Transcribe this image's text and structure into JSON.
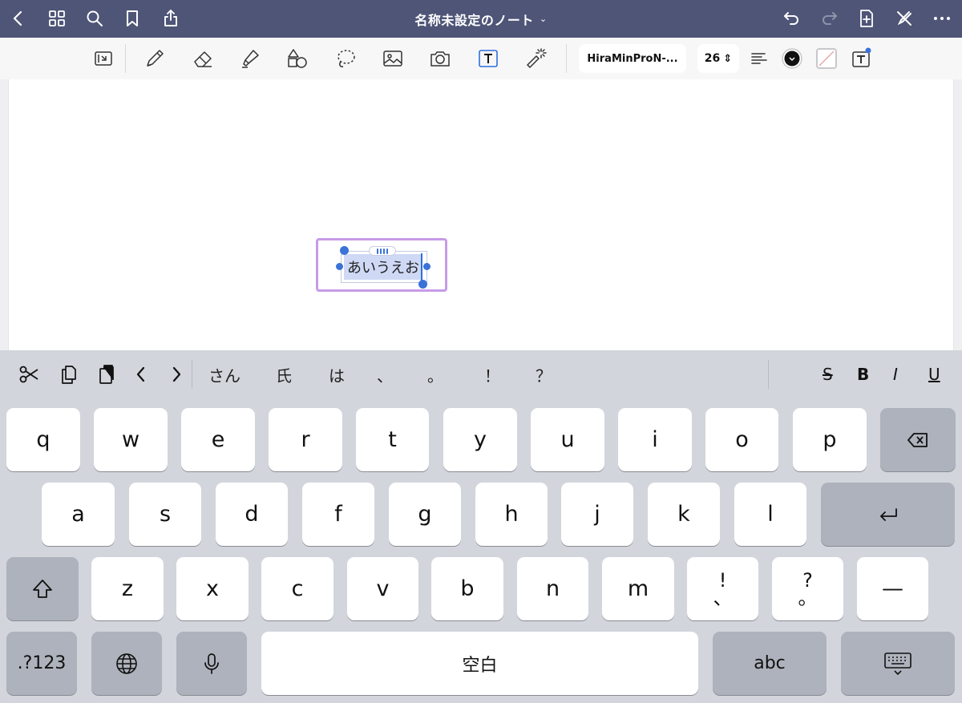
{
  "titlebar": {
    "title": "名称未設定のノート",
    "title_chevron": "⌄",
    "bg_color": "#4e5577"
  },
  "toolbar": {
    "font_name": "HiraMinProN-...",
    "font_size": "26",
    "font_size_chevron": "⇕"
  },
  "canvas": {
    "text_box_content": "あいうえお",
    "selection_color": "#cfd9f5",
    "frame_color": "#c79be8"
  },
  "suggestions": {
    "items": [
      "さん",
      "氏",
      "は",
      "、",
      "。",
      "！",
      "？"
    ]
  },
  "format": {
    "strike": "S",
    "bold": "B",
    "italic": "I",
    "underline": "U"
  },
  "keyboard": {
    "row1": [
      "q",
      "w",
      "e",
      "r",
      "t",
      "y",
      "u",
      "i",
      "o",
      "p"
    ],
    "row2": [
      "a",
      "s",
      "d",
      "f",
      "g",
      "h",
      "j",
      "k",
      "l"
    ],
    "row3": [
      "z",
      "x",
      "c",
      "v",
      "b",
      "n",
      "m"
    ],
    "excl_top": "!",
    "excl_bottom": "、",
    "quest_top": "?",
    "quest_bottom": "。",
    "dash": "—",
    "numbers_label": ".?123",
    "space_label": "空白",
    "abc_label": "abc"
  }
}
